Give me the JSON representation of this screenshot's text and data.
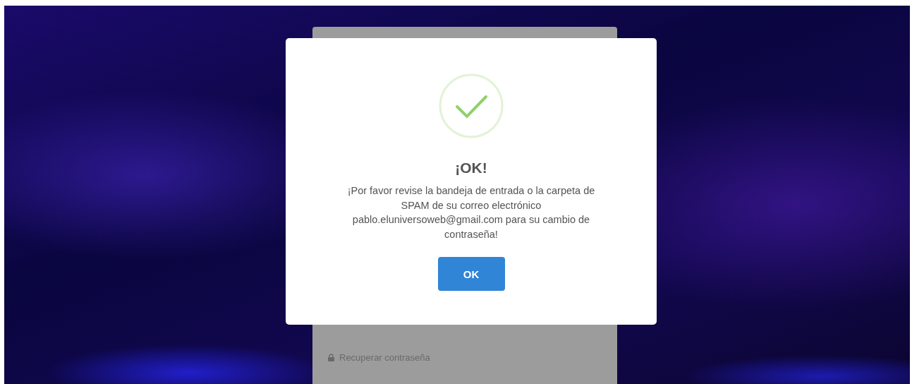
{
  "login_card": {
    "recover_link": "Recuperar contraseña"
  },
  "dialog": {
    "title": "¡OK!",
    "message": "¡Por favor revise la bandeja de entrada o la carpeta de SPAM de su correo electrónico pablo.eluniversoweb@gmail.com para su cambio de contraseña!",
    "button": "OK"
  }
}
